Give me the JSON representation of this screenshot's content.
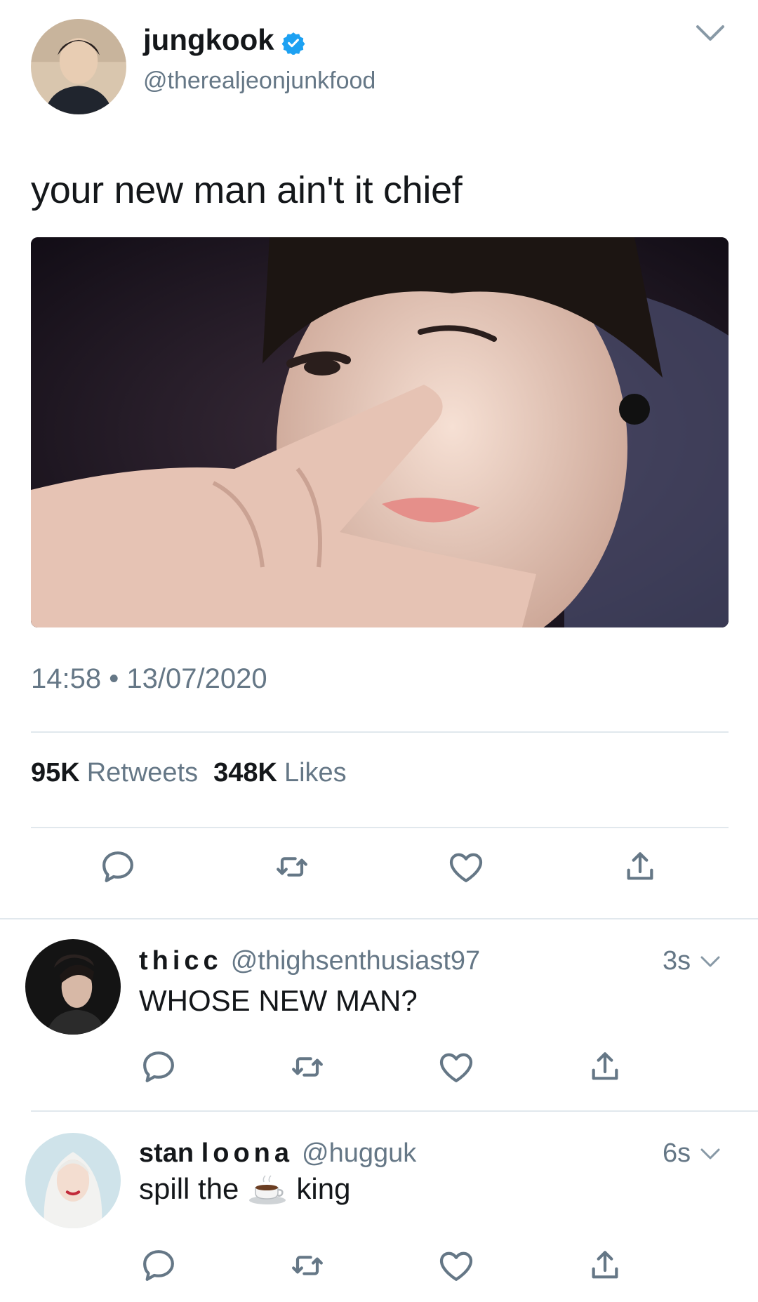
{
  "tweet": {
    "author_name": "jungkook",
    "author_handle": "@therealjeonjunkfood",
    "text": "your new man ain't it chief",
    "time": "14:58",
    "separator": "•",
    "date": "13/07/2020",
    "retweets_count": "95K",
    "retweets_label": "Retweets",
    "likes_count": "348K",
    "likes_label": "Likes"
  },
  "replies": [
    {
      "name": "thicc",
      "handle": "@thighsenthusiast97",
      "time": "3s",
      "text": "WHOSE NEW MAN?"
    },
    {
      "name_part1": "stan",
      "name_part2": "loona",
      "handle": "@hugguk",
      "time": "6s",
      "text_before": "spill the",
      "text_after": "king"
    }
  ],
  "colors": {
    "text": "#14171a",
    "secondary": "#657786",
    "verified": "#1da1f2",
    "divider": "#e1e8ed"
  },
  "icons": [
    "verified-badge-icon",
    "chevron-down-icon",
    "reply-icon",
    "retweet-icon",
    "like-icon",
    "share-icon",
    "coffee-emoji-icon"
  ]
}
